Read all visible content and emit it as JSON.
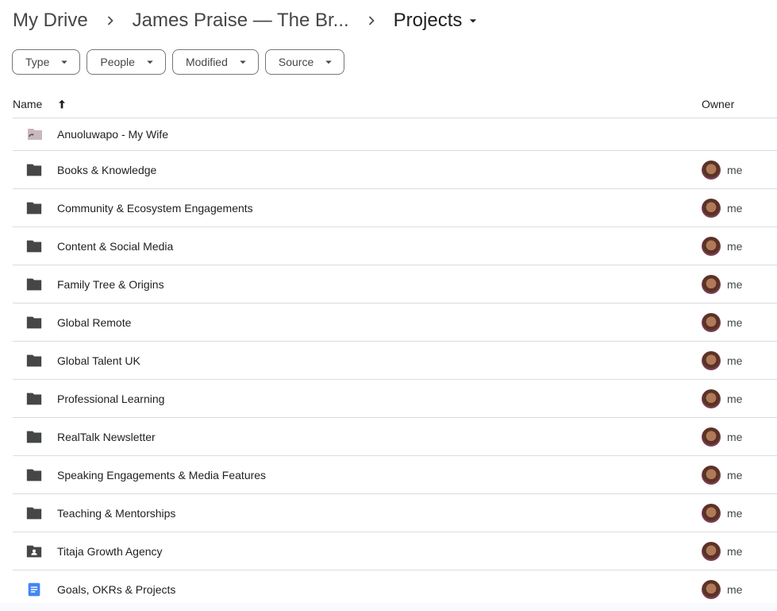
{
  "breadcrumb": {
    "root": "My Drive",
    "middle": "James Praise — The Br...",
    "current": "Projects"
  },
  "filters": [
    "Type",
    "People",
    "Modified",
    "Source"
  ],
  "table": {
    "name_header": "Name",
    "owner_header": "Owner",
    "sort_direction": "ascending"
  },
  "rows": [
    {
      "name": "Anuoluwapo - My Wife",
      "icon": "shared-shortcut-folder-icon",
      "owner": ""
    },
    {
      "name": "Books & Knowledge",
      "icon": "folder-icon",
      "owner": "me"
    },
    {
      "name": "Community & Ecosystem Engagements",
      "icon": "folder-icon",
      "owner": "me"
    },
    {
      "name": "Content & Social Media",
      "icon": "folder-icon",
      "owner": "me"
    },
    {
      "name": "Family Tree & Origins",
      "icon": "folder-icon",
      "owner": "me"
    },
    {
      "name": "Global Remote",
      "icon": "folder-icon",
      "owner": "me"
    },
    {
      "name": "Global Talent UK",
      "icon": "folder-icon",
      "owner": "me"
    },
    {
      "name": "Professional Learning",
      "icon": "folder-icon",
      "owner": "me"
    },
    {
      "name": "RealTalk Newsletter",
      "icon": "folder-icon",
      "owner": "me"
    },
    {
      "name": "Speaking Engagements & Media Features",
      "icon": "folder-icon",
      "owner": "me"
    },
    {
      "name": "Teaching & Mentorships",
      "icon": "folder-icon",
      "owner": "me"
    },
    {
      "name": "Titaja Growth Agency",
      "icon": "shared-folder-icon",
      "owner": "me"
    },
    {
      "name": "Goals, OKRs & Projects",
      "icon": "google-doc-icon",
      "owner": "me"
    }
  ],
  "colors": {
    "folder": "#444746",
    "shortcut_folder": "#c9b8be",
    "doc_blue": "#4285f4"
  }
}
